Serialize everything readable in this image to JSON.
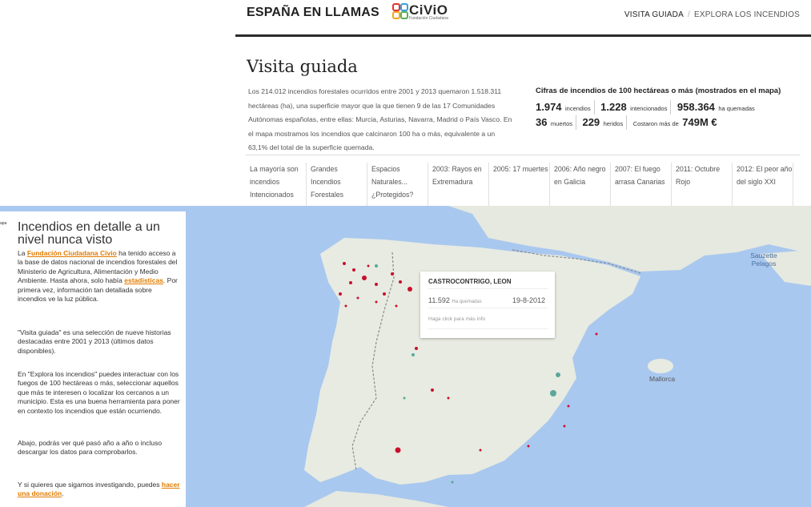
{
  "header": {
    "brand": "ESPAÑA EN LLAMAS",
    "logo_text": "CiViO",
    "logo_sub": "Fundación Ciudadana",
    "nav": [
      "VISITA GUIADA",
      "EXPLORA LOS INCENDIOS"
    ]
  },
  "intro": {
    "title": "Visita guiada",
    "text": "Los 214.012 incendios forestales ocurridos entre 2001 y 2013 quemaron 1.518.311 hectáreas (ha), una superficie mayor que la que tienen 9 de las 17 Comunidades Autónomas españolas, entre ellas: Murcia, Asturias, Navarra, Madrid o País Vasco. En el mapa mostramos los incendios que calcinaron 100 ha o más, equivalente a un 63,1% del total de la superficie quemada."
  },
  "stats": {
    "heading": "Cifras de incendios de 100 hectáreas o más (mostrados en el mapa)",
    "fires": "1.974",
    "fires_label": "incendios",
    "intentional": "1.228",
    "intentional_label": "intencionados",
    "hectares": "958.364",
    "hectares_label": "ha quemadas",
    "deaths": "36",
    "deaths_label": "muertos",
    "injured": "229",
    "injured_label": "heridos",
    "cost_label": "Costaron más de",
    "cost": "749M €"
  },
  "tabs": [
    "La mayoría son incendios Intencionados",
    "Grandes Incendios Forestales",
    "Espacios Naturales... ¿Protegidos?",
    "2003: Rayos en Extremadura",
    "2005: 17 muertes",
    "2006: Año negro en Galicia",
    "2007: El fuego arrasa Canarias",
    "2011: Octubre Rojo",
    "2012: El peor año del siglo XXI"
  ],
  "map": {
    "labels": {
      "sea": "Sauzette Pelagos",
      "island": "Mallorca"
    },
    "colors": {
      "water": "#a9c8ef",
      "land": "#e8ebe2",
      "fire": "#c8102e",
      "natural": "#5aa79b"
    },
    "popup": {
      "place": "CASTROCONTRIGO, LEON",
      "ha": "11.592",
      "ha_label": "Ha quemadas",
      "date": "19-8-2012",
      "more": "Haga click para más info"
    }
  },
  "panel": {
    "edge_text": "apa",
    "title": "Incendios en detalle a un nivel nunca visto",
    "p1_prefix": "La ",
    "p1_link": "Fundación Ciudadana Civio",
    "p1_mid": " ha tenido acceso a la base de datos nacional de incendios forestales del Ministerio de Agricultura, Alimentación y Medio Ambiente. Hasta ahora, solo había ",
    "p1_link2": "estadísticas",
    "p1_suffix": ". Por primera vez, información tan detallada sobre incendios ve la luz pública.",
    "p2": "\"Visita guiada\" es una selección de nueve historias destacadas entre 2001 y 2013 (últimos datos disponibles).",
    "p3": "En \"Explora los incendios\" puedes interactuar con los fuegos de 100 hectáreas o más, seleccionar aquellos que más te interesen o localizar los cercanos a un municipio. Esta es una buena herramienta para poner en contexto los incendios que están ocurriendo.",
    "p4": "Abajo, podrás ver qué pasó año a año o incluso descargar los datos para comprobarlos.",
    "p5_prefix": "Y si quieres que sigamos investigando, puedes ",
    "p5_link": "hacer una donación",
    "p5_suffix": "."
  }
}
